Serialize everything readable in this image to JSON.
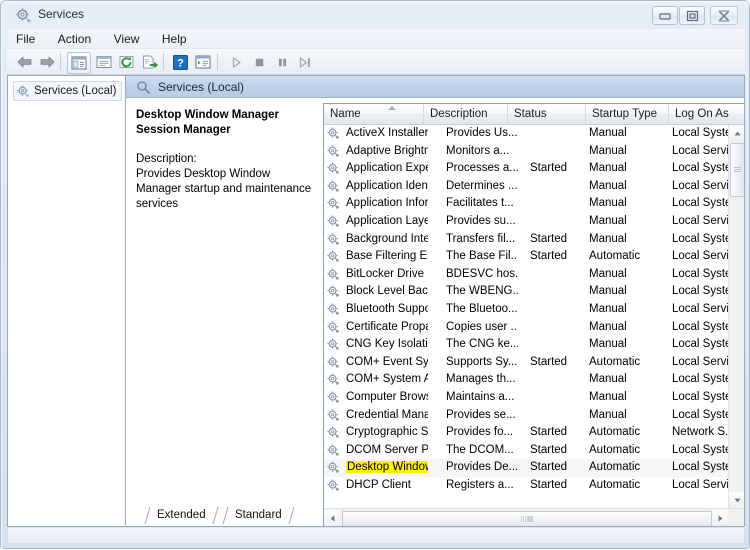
{
  "window": {
    "title": "Services",
    "icon": "services-gear-icon",
    "caption_buttons": {
      "minimize": "–",
      "maximize": "▣",
      "close": "✕"
    }
  },
  "menubar": {
    "items": [
      {
        "label": "File",
        "name": "menu-file"
      },
      {
        "label": "Action",
        "name": "menu-action"
      },
      {
        "label": "View",
        "name": "menu-view"
      },
      {
        "label": "Help",
        "name": "menu-help"
      }
    ]
  },
  "toolbar": {
    "buttons": [
      {
        "name": "back-icon",
        "glyph": "⇦",
        "enabled": true
      },
      {
        "name": "forward-icon",
        "glyph": "⇨",
        "enabled": true
      },
      {
        "name": "show-hide-console-tree-icon",
        "glyph": "▤",
        "enabled": true
      },
      {
        "name": "properties-icon",
        "glyph": "▥",
        "enabled": true
      },
      {
        "name": "refresh-icon",
        "glyph": "↻",
        "enabled": true
      },
      {
        "name": "export-list-icon",
        "glyph": "➡",
        "enabled": true
      },
      {
        "name": "help-icon",
        "glyph": "?",
        "enabled": true
      },
      {
        "name": "show-action-pane-icon",
        "glyph": "▦",
        "enabled": true
      },
      {
        "name": "start-service-icon",
        "glyph": "▶",
        "enabled": false
      },
      {
        "name": "stop-service-icon",
        "glyph": "■",
        "enabled": false
      },
      {
        "name": "pause-service-icon",
        "glyph": "❙❙",
        "enabled": false
      },
      {
        "name": "restart-service-icon",
        "glyph": "▷❙",
        "enabled": false
      }
    ]
  },
  "scope_pane": {
    "node_label": "Services (Local)",
    "node_icon": "services-gear-icon"
  },
  "result_pane": {
    "header_label": "Services (Local)",
    "header_icon": "services-magnifier-icon"
  },
  "detail": {
    "service_title": "Desktop Window Manager Session Manager",
    "description_label": "Description:",
    "description_text": "Provides Desktop Window Manager startup and maintenance services"
  },
  "list": {
    "columns": [
      {
        "label": "Name",
        "name": "column-name",
        "sorted": true
      },
      {
        "label": "Description",
        "name": "column-description",
        "sorted": false
      },
      {
        "label": "Status",
        "name": "column-status",
        "sorted": false
      },
      {
        "label": "Startup Type",
        "name": "column-startup-type",
        "sorted": false
      },
      {
        "label": "Log On As",
        "name": "column-log-on-as",
        "sorted": false
      }
    ],
    "rows": [
      {
        "name": "ActiveX Installer (...",
        "description": "Provides Us...",
        "status": "",
        "startup": "Manual",
        "logon": "Local Syste...",
        "highlight": false
      },
      {
        "name": "Adaptive Brightness",
        "description": "Monitors a...",
        "status": "",
        "startup": "Manual",
        "logon": "Local Service",
        "highlight": false
      },
      {
        "name": "Application Experi...",
        "description": "Processes a...",
        "status": "Started",
        "startup": "Manual",
        "logon": "Local Syste...",
        "highlight": false
      },
      {
        "name": "Application Identity",
        "description": "Determines ...",
        "status": "",
        "startup": "Manual",
        "logon": "Local Service",
        "highlight": false
      },
      {
        "name": "Application Infor...",
        "description": "Facilitates t...",
        "status": "",
        "startup": "Manual",
        "logon": "Local Syste...",
        "highlight": false
      },
      {
        "name": "Application Layer ...",
        "description": "Provides su...",
        "status": "",
        "startup": "Manual",
        "logon": "Local Service",
        "highlight": false
      },
      {
        "name": "Background Intelli...",
        "description": "Transfers fil...",
        "status": "Started",
        "startup": "Manual",
        "logon": "Local Syste...",
        "highlight": false
      },
      {
        "name": "Base Filtering Engi...",
        "description": "The Base Fil...",
        "status": "Started",
        "startup": "Automatic",
        "logon": "Local Service",
        "highlight": false
      },
      {
        "name": "BitLocker Drive En...",
        "description": "BDESVC hos...",
        "status": "",
        "startup": "Manual",
        "logon": "Local Syste...",
        "highlight": false
      },
      {
        "name": "Block Level Backu...",
        "description": "The WBENG...",
        "status": "",
        "startup": "Manual",
        "logon": "Local Syste...",
        "highlight": false
      },
      {
        "name": "Bluetooth Support...",
        "description": "The Bluetoo...",
        "status": "",
        "startup": "Manual",
        "logon": "Local Service",
        "highlight": false
      },
      {
        "name": "Certificate Propag...",
        "description": "Copies user ...",
        "status": "",
        "startup": "Manual",
        "logon": "Local Syste...",
        "highlight": false
      },
      {
        "name": "CNG Key Isolation",
        "description": "The CNG ke...",
        "status": "",
        "startup": "Manual",
        "logon": "Local Syste...",
        "highlight": false
      },
      {
        "name": "COM+ Event Syst...",
        "description": "Supports Sy...",
        "status": "Started",
        "startup": "Automatic",
        "logon": "Local Service",
        "highlight": false
      },
      {
        "name": "COM+ System Ap...",
        "description": "Manages th...",
        "status": "",
        "startup": "Manual",
        "logon": "Local Syste...",
        "highlight": false
      },
      {
        "name": "Computer Browser",
        "description": "Maintains a...",
        "status": "",
        "startup": "Manual",
        "logon": "Local Syste...",
        "highlight": false
      },
      {
        "name": "Credential Manager",
        "description": "Provides se...",
        "status": "",
        "startup": "Manual",
        "logon": "Local Syste...",
        "highlight": false
      },
      {
        "name": "Cryptographic Ser...",
        "description": "Provides fo...",
        "status": "Started",
        "startup": "Automatic",
        "logon": "Network S...",
        "highlight": false
      },
      {
        "name": "DCOM Server Pro...",
        "description": "The DCOM...",
        "status": "Started",
        "startup": "Automatic",
        "logon": "Local Syste...",
        "highlight": false
      },
      {
        "name": "Desktop Window ...",
        "description": "Provides De...",
        "status": "Started",
        "startup": "Automatic",
        "logon": "Local Syste...",
        "highlight": true
      },
      {
        "name": "DHCP Client",
        "description": "Registers a...",
        "status": "Started",
        "startup": "Automatic",
        "logon": "Local Servic...",
        "highlight": false
      }
    ],
    "highlight_color": "#fff200"
  },
  "tabs": [
    {
      "label": "Extended",
      "name": "tab-extended",
      "selected": true
    },
    {
      "label": "Standard",
      "name": "tab-standard",
      "selected": false
    }
  ],
  "scrollbars": {
    "vertical_up": "▲",
    "vertical_down": "▼",
    "horizontal_left": "◀",
    "horizontal_right": "▶"
  }
}
